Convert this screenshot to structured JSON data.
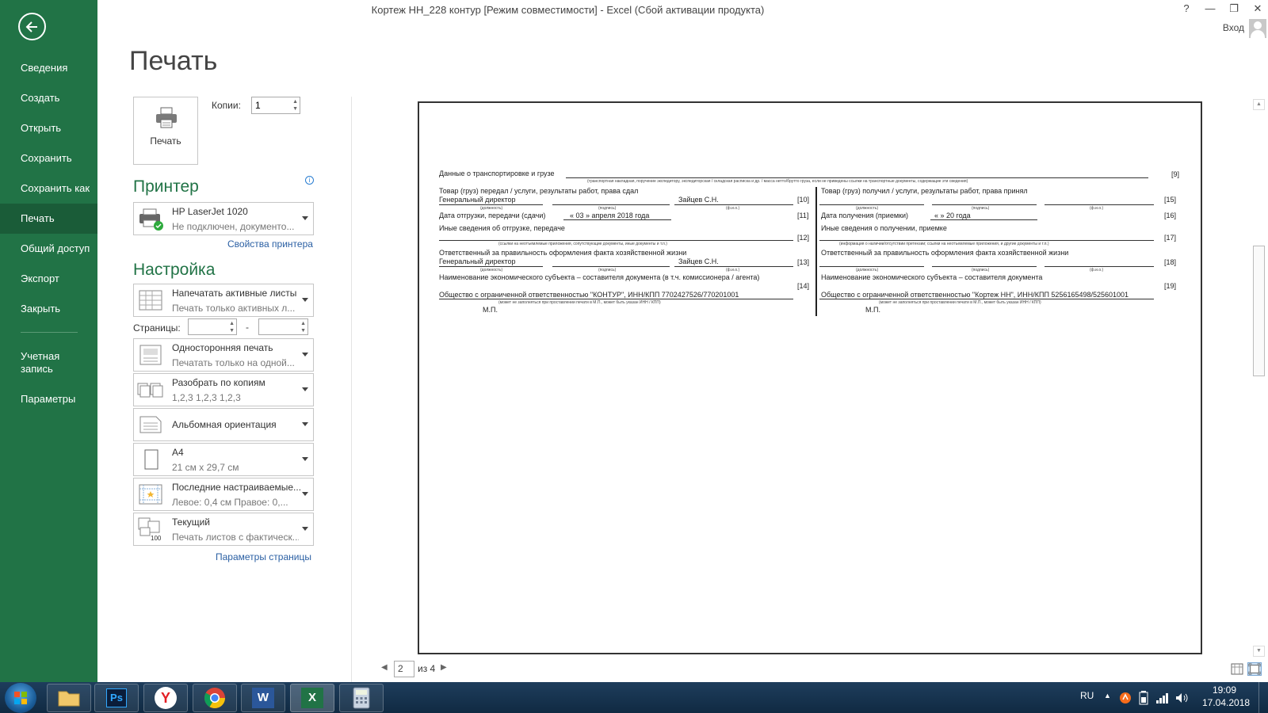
{
  "window": {
    "title": "Кортеж НН_228 контур  [Режим совместимости] - Excel (Сбой активации продукта)",
    "help": "?",
    "minimize": "—",
    "restore": "❐",
    "close": "✕",
    "signin": "Вход"
  },
  "sidebar": {
    "items": [
      "Сведения",
      "Создать",
      "Открыть",
      "Сохранить",
      "Сохранить как",
      "Печать",
      "Общий доступ",
      "Экспорт",
      "Закрыть",
      "Учетная запись",
      "Параметры"
    ],
    "active": "Печать"
  },
  "print": {
    "page_title": "Печать",
    "print_button": "Печать",
    "copies_label": "Копии:",
    "copies_value": "1",
    "printer_header": "Принтер",
    "printer_name": "HP LaserJet 1020",
    "printer_status": "Не подключен, документо...",
    "printer_props_link": "Свойства принтера",
    "settings_header": "Настройка",
    "settings": [
      {
        "title": "Напечатать активные листы",
        "sub": "Печать только активных л..."
      },
      {
        "title": "Односторонняя печать",
        "sub": "Печатать только на одной..."
      },
      {
        "title": "Разобрать по копиям",
        "sub": "1,2,3    1,2,3    1,2,3"
      },
      {
        "title": "Альбомная ориентация",
        "sub": ""
      },
      {
        "title": "А4",
        "sub": "21 см x 29,7 см"
      },
      {
        "title": "Последние настраиваемые...",
        "sub": "Левое: 0,4 см    Правое: 0,..."
      },
      {
        "title": "Текущий",
        "sub": "Печать листов с фактическ..."
      }
    ],
    "pages_label": "Страницы:",
    "pages_dash": "-",
    "page_setup_link": "Параметры страницы"
  },
  "preview": {
    "page_current": "2",
    "page_of": "из 4",
    "doc": {
      "transport": "Данные о транспортировке и грузе",
      "transport_hint": "(транспортная накладная, поручение экспедитору, экспедиторская / складская расписка и др. / масса нетто/брутто груза, если не приведены ссылки на транспортные документы, содержащие эти сведения)",
      "n9": "[9]",
      "left_handed": "Товар (груз) передал / услуги, результаты работ, права сдал",
      "left_pos": "Генеральный директор",
      "left_fio": "Зайцев С.Н.",
      "n10": "[10]",
      "lbl_position": "(должность)",
      "lbl_sign": "(подпись)",
      "lbl_fio": "(ф.и.о.)",
      "ship_date": "Дата отгрузки, передачи (сдачи)",
      "ship_date_val": "« 03 »    апреля    2018  года",
      "n11": "[11]",
      "other_ship": "Иные сведения об отгрузке, передаче",
      "other_ship_hint": "(ссылки на неотъемлемые приложения, сопутствующие документы, иные документы и т.п.)",
      "n12": "[12]",
      "resp_left": "Ответственный за правильность оформления факта хозяйственной жизни",
      "resp_left_pos": "Генеральный директор",
      "resp_left_fio": "Зайцев С.Н.",
      "n13": "[13]",
      "econ_left": "Наименование экономического субъекта – составителя документа (в т.ч. комиссионера / агента)",
      "n14": "[14]",
      "org_left": "Общество с ограниченной ответственностью \"КОНТУР\", ИНН/КПП 7702427526/770201001",
      "stamp_hint": "(может не заполняться при проставлении печати в М.П., может быть указан ИНН / КПП)",
      "mp": "М.П.",
      "right_received": "Товар (груз) получил / услуги, результаты работ, права принял",
      "n15": "[15]",
      "recv_date": "Дата получения (приемки)",
      "recv_date_val": "«       »                    20      года",
      "n16": "[16]",
      "other_recv": "Иные сведения о получении, приемке",
      "other_recv_hint": "(информация о наличии/отсутствии претензии; ссылки на неотъемлемые приложения, и другие документы и т.п.)",
      "n17": "[17]",
      "resp_right": "Ответственный за правильность оформления факта хозяйственной жизни",
      "n18": "[18]",
      "econ_right": "Наименование экономического субъекта – составителя документа",
      "n19": "[19]",
      "org_right": "Общество с ограниченной ответственностью  \"Кортеж НН\", ИНН/КПП 5256165498/525601001"
    }
  },
  "taskbar": {
    "lang": "RU",
    "time": "19:09",
    "date": "17.04.2018",
    "apps": [
      "explorer",
      "photoshop",
      "yandex",
      "chrome",
      "word",
      "excel",
      "calculator"
    ],
    "ps_label": "Ps",
    "word_label": "W",
    "excel_label": "X",
    "yandex_label": "Y"
  },
  "colors": {
    "accent": "#217346",
    "link": "#2a5fa3"
  }
}
